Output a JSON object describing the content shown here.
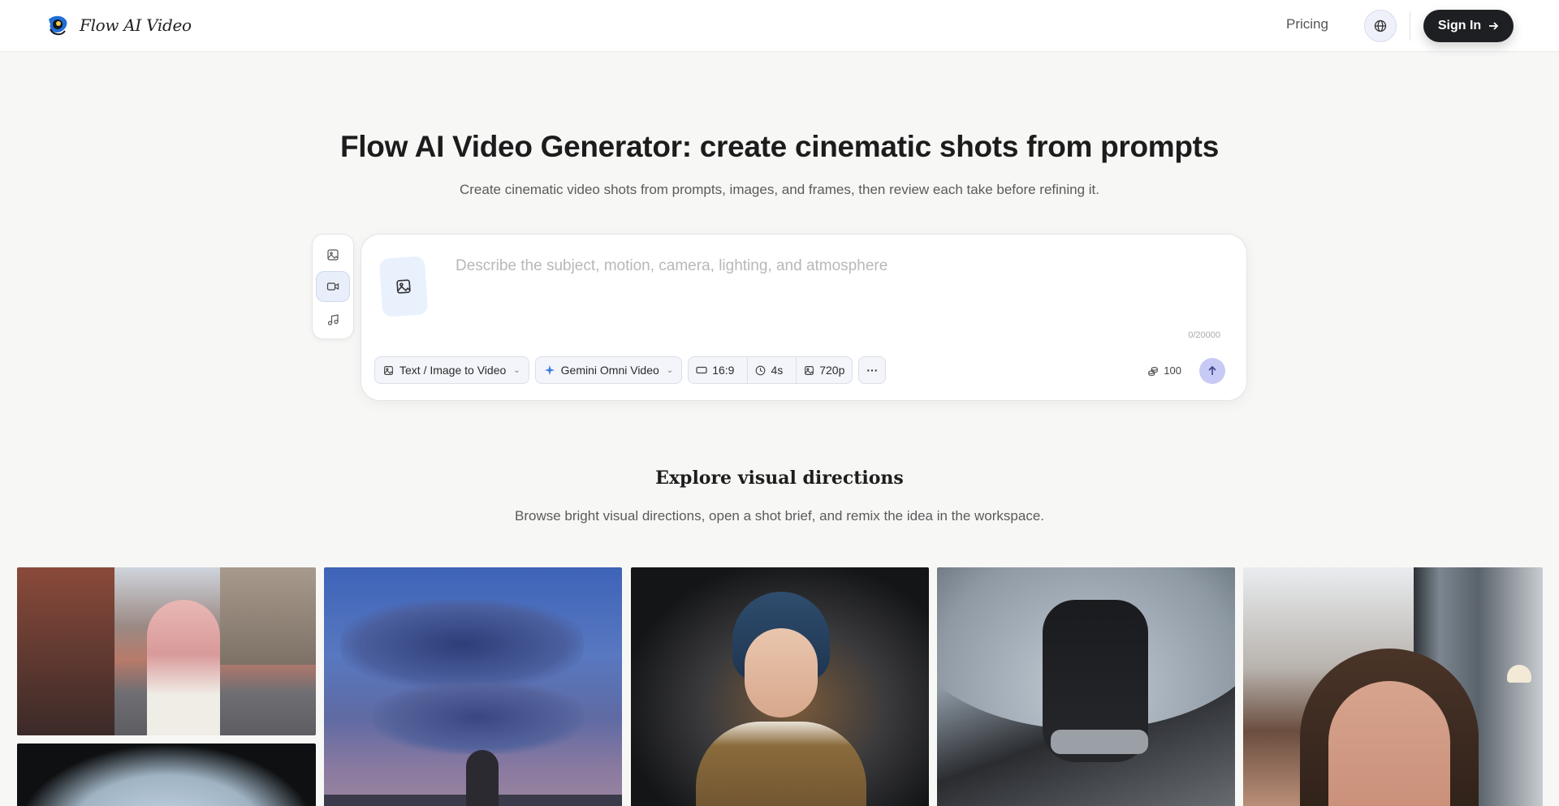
{
  "header": {
    "brand": "Flow AI Video",
    "nav_pricing": "Pricing",
    "signin_label": "Sign In"
  },
  "hero": {
    "title": "Flow AI Video Generator: create cinematic shots from prompts",
    "subtitle": "Create cinematic video shots from prompts, images, and frames, then review each take before refining it."
  },
  "composer": {
    "mode_rail": [
      {
        "icon": "image-icon",
        "active": false
      },
      {
        "icon": "video-icon",
        "active": true
      },
      {
        "icon": "music-icon",
        "active": false
      }
    ],
    "placeholder": "Describe the subject, motion, camera, lighting, and atmosphere",
    "char_count": "0/20000",
    "mode_select": "Text / Image to Video",
    "model_select": "Gemini Omni Video",
    "aspect_ratio": "16:9",
    "duration": "4s",
    "resolution": "720p",
    "more_label": "···",
    "credits": "100"
  },
  "explore": {
    "title": "Explore visual directions",
    "subtitle": "Browse bright visual directions, open a shot brief, and remix the idea in the workspace."
  },
  "colors": {
    "accent": "#c6caf4",
    "primary_button": "#1d1f22",
    "page_bg": "#f7f7f6"
  }
}
